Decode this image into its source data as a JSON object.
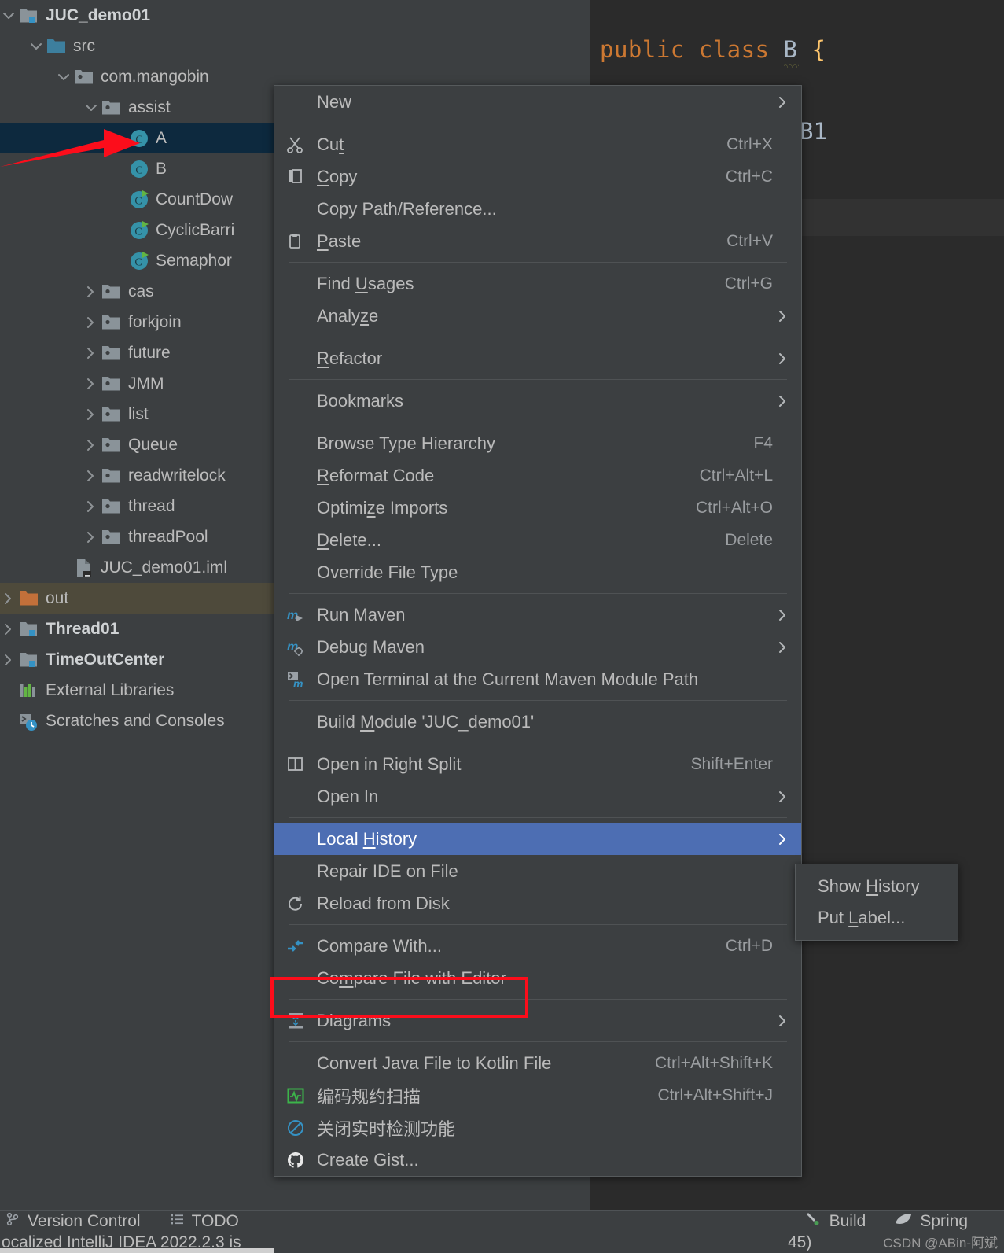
{
  "editor": {
    "code_keyword1": "public",
    "code_keyword2": "class",
    "code_classname": "B",
    "code_brace": "{",
    "code_fragment": "B1"
  },
  "project_tree": [
    {
      "label": "JUC_demo01",
      "icon": "module-icon",
      "arrow": "chevron-down",
      "indent": 0,
      "bold": true,
      "state": "normal"
    },
    {
      "label": "src",
      "icon": "source-folder-icon",
      "arrow": "chevron-down",
      "indent": 1,
      "bold": false,
      "state": "normal"
    },
    {
      "label": "com.mangobin",
      "icon": "package-icon",
      "arrow": "chevron-down",
      "indent": 2,
      "bold": false,
      "state": "normal"
    },
    {
      "label": "assist",
      "icon": "package-icon",
      "arrow": "chevron-down",
      "indent": 3,
      "bold": false,
      "state": "normal"
    },
    {
      "label": "A",
      "icon": "java-class-icon",
      "arrow": "none",
      "indent": 4,
      "bold": false,
      "state": "selected"
    },
    {
      "label": "B",
      "icon": "java-class-icon",
      "arrow": "none",
      "indent": 4,
      "bold": false,
      "state": "normal"
    },
    {
      "label": "CountDow",
      "icon": "java-class-runnable-icon",
      "arrow": "none",
      "indent": 4,
      "bold": false,
      "state": "normal"
    },
    {
      "label": "CyclicBarri",
      "icon": "java-class-runnable-icon",
      "arrow": "none",
      "indent": 4,
      "bold": false,
      "state": "normal"
    },
    {
      "label": "Semaphor",
      "icon": "java-class-runnable-icon",
      "arrow": "none",
      "indent": 4,
      "bold": false,
      "state": "normal"
    },
    {
      "label": "cas",
      "icon": "package-icon",
      "arrow": "chevron-right",
      "indent": 3,
      "bold": false,
      "state": "normal"
    },
    {
      "label": "forkjoin",
      "icon": "package-icon",
      "arrow": "chevron-right",
      "indent": 3,
      "bold": false,
      "state": "normal"
    },
    {
      "label": "future",
      "icon": "package-icon",
      "arrow": "chevron-right",
      "indent": 3,
      "bold": false,
      "state": "normal"
    },
    {
      "label": "JMM",
      "icon": "package-icon",
      "arrow": "chevron-right",
      "indent": 3,
      "bold": false,
      "state": "normal"
    },
    {
      "label": "list",
      "icon": "package-icon",
      "arrow": "chevron-right",
      "indent": 3,
      "bold": false,
      "state": "normal"
    },
    {
      "label": "Queue",
      "icon": "package-icon",
      "arrow": "chevron-right",
      "indent": 3,
      "bold": false,
      "state": "normal"
    },
    {
      "label": "readwritelock",
      "icon": "package-icon",
      "arrow": "chevron-right",
      "indent": 3,
      "bold": false,
      "state": "normal"
    },
    {
      "label": "thread",
      "icon": "package-icon",
      "arrow": "chevron-right",
      "indent": 3,
      "bold": false,
      "state": "normal"
    },
    {
      "label": "threadPool",
      "icon": "package-icon",
      "arrow": "chevron-right",
      "indent": 3,
      "bold": false,
      "state": "normal"
    },
    {
      "label": "JUC_demo01.iml",
      "icon": "iml-file-icon",
      "arrow": "none",
      "indent": 2,
      "bold": false,
      "state": "normal"
    },
    {
      "label": "out",
      "icon": "excluded-folder-icon",
      "arrow": "chevron-right",
      "indent": 0,
      "bold": false,
      "state": "hover"
    },
    {
      "label": "Thread01",
      "icon": "module-icon",
      "arrow": "chevron-right",
      "indent": 0,
      "bold": true,
      "state": "normal"
    },
    {
      "label": "TimeOutCenter",
      "icon": "module-icon",
      "arrow": "chevron-right",
      "indent": 0,
      "bold": true,
      "state": "normal"
    },
    {
      "label": "External Libraries",
      "icon": "libraries-icon",
      "arrow": "none",
      "indent": 0,
      "bold": false,
      "state": "normal"
    },
    {
      "label": "Scratches and Consoles",
      "icon": "scratches-icon",
      "arrow": "none",
      "indent": 0,
      "bold": false,
      "state": "normal"
    }
  ],
  "context_menu": [
    {
      "type": "item",
      "label": "New",
      "mnemonic": "",
      "accel": "",
      "icon": "none",
      "submenu": true,
      "highlight": false
    },
    {
      "type": "separator"
    },
    {
      "type": "item",
      "label": "Cut",
      "mnemonic": "t",
      "accel": "Ctrl+X",
      "icon": "scissors-icon",
      "submenu": false,
      "highlight": false
    },
    {
      "type": "item",
      "label": "Copy",
      "mnemonic": "C",
      "accel": "Ctrl+C",
      "icon": "copy-icon",
      "submenu": false,
      "highlight": false
    },
    {
      "type": "item",
      "label": "Copy Path/Reference...",
      "mnemonic": "",
      "accel": "",
      "icon": "none",
      "submenu": false,
      "highlight": false
    },
    {
      "type": "item",
      "label": "Paste",
      "mnemonic": "P",
      "accel": "Ctrl+V",
      "icon": "clipboard-icon",
      "submenu": false,
      "highlight": false
    },
    {
      "type": "separator"
    },
    {
      "type": "item",
      "label": "Find Usages",
      "mnemonic": "U",
      "accel": "Ctrl+G",
      "icon": "none",
      "submenu": false,
      "highlight": false
    },
    {
      "type": "item",
      "label": "Analyze",
      "mnemonic": "z",
      "accel": "",
      "icon": "none",
      "submenu": true,
      "highlight": false
    },
    {
      "type": "separator"
    },
    {
      "type": "item",
      "label": "Refactor",
      "mnemonic": "R",
      "accel": "",
      "icon": "none",
      "submenu": true,
      "highlight": false
    },
    {
      "type": "separator"
    },
    {
      "type": "item",
      "label": "Bookmarks",
      "mnemonic": "",
      "accel": "",
      "icon": "none",
      "submenu": true,
      "highlight": false
    },
    {
      "type": "separator"
    },
    {
      "type": "item",
      "label": "Browse Type Hierarchy",
      "mnemonic": "",
      "accel": "F4",
      "icon": "none",
      "submenu": false,
      "highlight": false
    },
    {
      "type": "item",
      "label": "Reformat Code",
      "mnemonic": "R",
      "accel": "Ctrl+Alt+L",
      "icon": "none",
      "submenu": false,
      "highlight": false
    },
    {
      "type": "item",
      "label": "Optimize Imports",
      "mnemonic": "z",
      "accel": "Ctrl+Alt+O",
      "icon": "none",
      "submenu": false,
      "highlight": false
    },
    {
      "type": "item",
      "label": "Delete...",
      "mnemonic": "D",
      "accel": "Delete",
      "icon": "none",
      "submenu": false,
      "highlight": false
    },
    {
      "type": "item",
      "label": "Override File Type",
      "mnemonic": "",
      "accel": "",
      "icon": "none",
      "submenu": false,
      "highlight": false
    },
    {
      "type": "separator"
    },
    {
      "type": "item",
      "label": "Run Maven",
      "mnemonic": "",
      "accel": "",
      "icon": "maven-run-icon",
      "submenu": true,
      "highlight": false
    },
    {
      "type": "item",
      "label": "Debug Maven",
      "mnemonic": "",
      "accel": "",
      "icon": "maven-debug-icon",
      "submenu": true,
      "highlight": false
    },
    {
      "type": "item",
      "label": "Open Terminal at the Current Maven Module Path",
      "mnemonic": "",
      "accel": "",
      "icon": "terminal-maven-icon",
      "submenu": false,
      "highlight": false
    },
    {
      "type": "separator"
    },
    {
      "type": "item",
      "label": "Build Module 'JUC_demo01'",
      "mnemonic": "M",
      "accel": "",
      "icon": "none",
      "submenu": false,
      "highlight": false
    },
    {
      "type": "separator"
    },
    {
      "type": "item",
      "label": "Open in Right Split",
      "mnemonic": "",
      "accel": "Shift+Enter",
      "icon": "split-icon",
      "submenu": false,
      "highlight": false
    },
    {
      "type": "item",
      "label": "Open In",
      "mnemonic": "",
      "accel": "",
      "icon": "none",
      "submenu": true,
      "highlight": false
    },
    {
      "type": "separator"
    },
    {
      "type": "item",
      "label": "Local History",
      "mnemonic": "H",
      "accel": "",
      "icon": "none",
      "submenu": true,
      "highlight": true
    },
    {
      "type": "item",
      "label": "Repair IDE on File",
      "mnemonic": "",
      "accel": "",
      "icon": "none",
      "submenu": false,
      "highlight": false
    },
    {
      "type": "item",
      "label": "Reload from Disk",
      "mnemonic": "",
      "accel": "",
      "icon": "reload-icon",
      "submenu": false,
      "highlight": false
    },
    {
      "type": "separator"
    },
    {
      "type": "item",
      "label": "Compare With...",
      "mnemonic": "",
      "accel": "Ctrl+D",
      "icon": "compare-icon",
      "submenu": false,
      "highlight": false
    },
    {
      "type": "item",
      "label": "Compare File with Editor",
      "mnemonic": "m",
      "accel": "",
      "icon": "none",
      "submenu": false,
      "highlight": false
    },
    {
      "type": "separator"
    },
    {
      "type": "item",
      "label": "Diagrams",
      "mnemonic": "",
      "accel": "",
      "icon": "diagrams-icon",
      "submenu": true,
      "highlight": false
    },
    {
      "type": "separator"
    },
    {
      "type": "item",
      "label": "Convert Java File to Kotlin File",
      "mnemonic": "",
      "accel": "Ctrl+Alt+Shift+K",
      "icon": "none",
      "submenu": false,
      "highlight": false
    },
    {
      "type": "item",
      "label": "编码规约扫描",
      "mnemonic": "",
      "accel": "Ctrl+Alt+Shift+J",
      "icon": "alibaba-scan-icon",
      "submenu": false,
      "highlight": false
    },
    {
      "type": "item",
      "label": "关闭实时检测功能",
      "mnemonic": "",
      "accel": "",
      "icon": "disable-realtime-icon",
      "submenu": false,
      "highlight": false
    },
    {
      "type": "item",
      "label": "Create Gist...",
      "mnemonic": "",
      "accel": "",
      "icon": "github-icon",
      "submenu": false,
      "highlight": false
    }
  ],
  "submenu": {
    "items": [
      {
        "label": "Show History",
        "mnemonic": "H"
      },
      {
        "label": "Put Label...",
        "mnemonic": "L"
      }
    ]
  },
  "status_bar": {
    "left": [
      {
        "label": "Version Control",
        "icon": "branch-icon"
      },
      {
        "label": "TODO",
        "icon": "todo-list-icon"
      }
    ],
    "right": [
      {
        "label": "Build",
        "icon": "build-hammer-icon"
      },
      {
        "label": "Spring",
        "icon": "spring-leaf-icon"
      }
    ]
  },
  "message_bar": {
    "left_text": "ocalized IntelliJ IDEA 2022.2.3 is",
    "right_text": "45)",
    "watermark": "CSDN @ABin-阿斌"
  },
  "colors": {
    "background": "#3c3f41",
    "editor_background": "#2b2b2b",
    "selection": "#0d293e",
    "menu_highlight": "#4d6eb3",
    "annotation_red": "#fc0d1b",
    "excluded_orange": "#c2703a",
    "keyword_orange": "#cc7832",
    "brace_yellow": "#ffc66d"
  }
}
